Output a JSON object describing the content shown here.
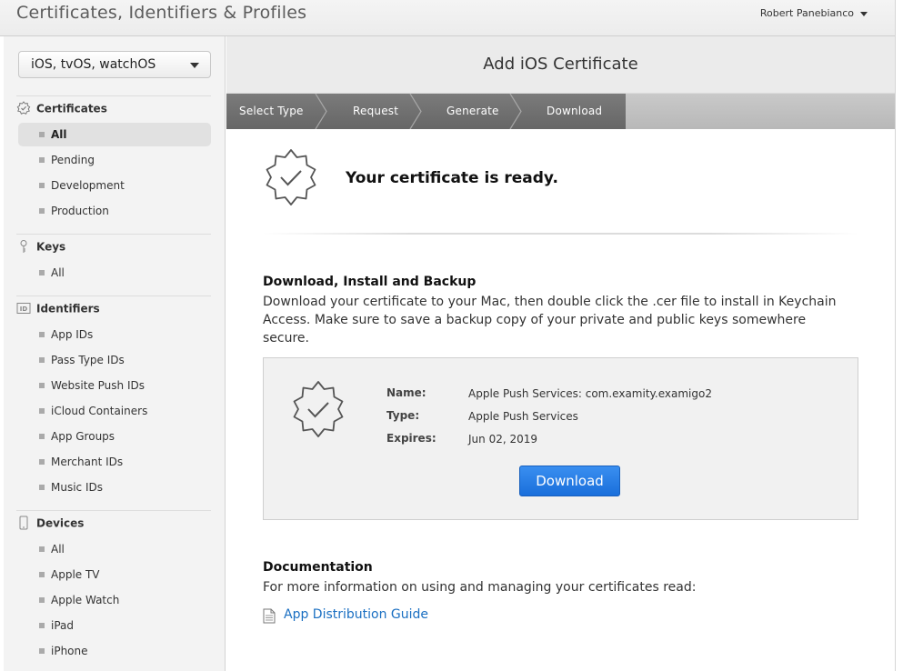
{
  "header": {
    "title": "Certificates, Identifiers & Profiles",
    "user_name": "Robert Panebianco"
  },
  "sidebar": {
    "platform": "iOS, tvOS, watchOS",
    "certificates": {
      "title": "Certificates",
      "icon": "certificate-icon",
      "items": [
        "All",
        "Pending",
        "Development",
        "Production"
      ]
    },
    "keys": {
      "title": "Keys",
      "icon": "key-icon",
      "items": [
        "All"
      ]
    },
    "identifiers": {
      "title": "Identifiers",
      "icon": "id-icon",
      "items": [
        "App IDs",
        "Pass Type IDs",
        "Website Push IDs",
        "iCloud Containers",
        "App Groups",
        "Merchant IDs",
        "Music IDs"
      ]
    },
    "devices": {
      "title": "Devices",
      "icon": "device-icon",
      "items": [
        "All",
        "Apple TV",
        "Apple Watch",
        "iPad",
        "iPhone"
      ]
    }
  },
  "main": {
    "page_title": "Add iOS Certificate",
    "steps": [
      "Select Type",
      "Request",
      "Generate",
      "Download"
    ],
    "ready_message": "Your certificate is ready.",
    "install": {
      "heading": "Download, Install and Backup",
      "body": "Download your certificate to your Mac, then double click the .cer file to install in Keychain Access. Make sure to save a backup copy of your private and public keys somewhere secure."
    },
    "certificate": {
      "name_label": "Name:",
      "name_value": "Apple Push Services: com.examity.examigo2",
      "type_label": "Type:",
      "type_value": "Apple Push Services",
      "expires_label": "Expires:",
      "expires_value": "Jun 02, 2019",
      "download_label": "Download"
    },
    "documentation": {
      "heading": "Documentation",
      "body": "For more information on using and managing your certificates read:",
      "link_text": "App Distribution Guide"
    }
  },
  "colors": {
    "accent": "#1a6fdb",
    "link": "#1a6fc2",
    "step_active": "#707070",
    "step_inactive": "#bdbdbd"
  }
}
